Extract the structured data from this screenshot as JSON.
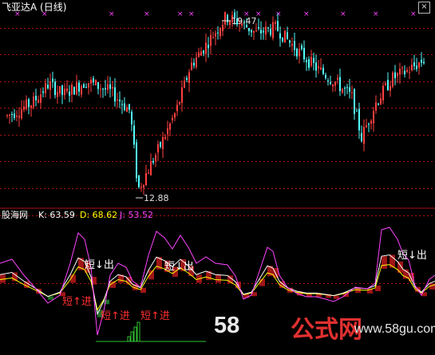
{
  "main_panel": {
    "title": "飞亚达A (日线)",
    "title_color": "#ffffff",
    "high_label": "19.47",
    "low_label": "12.88",
    "up_color": "#ff4040",
    "down_color": "#54ffff",
    "close_icon": "close-icon",
    "price_grid": [
      12,
      13,
      14,
      15,
      16,
      17,
      18,
      19
    ]
  },
  "indicator_panel": {
    "name": "股海网",
    "k_label": "K: 63.59",
    "d_label": "D: 68.62",
    "j_label": "J: 53.52",
    "k_color": "#ffffff",
    "d_color": "#ffff00",
    "j_color": "#ff44ff",
    "signals": [
      "短↓出",
      "短↓出",
      "短↑进",
      "短↑进",
      "短↑进",
      "短↓出"
    ],
    "signal_sell_color": "#ffffff",
    "signal_buy_color": "#ff3030"
  },
  "watermark": {
    "number": "58",
    "text": "公式网",
    "url": "www.58gu.com"
  }
}
